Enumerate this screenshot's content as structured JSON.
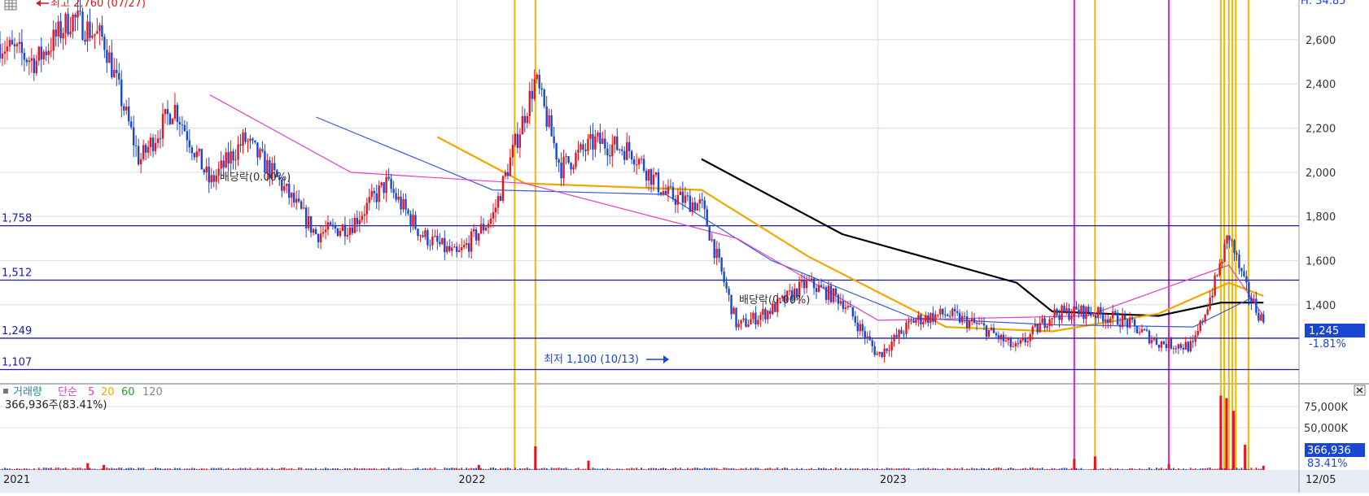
{
  "colors": {
    "price_up": "#e8141b",
    "price_down": "#1a46d6",
    "support_line": "#1a1aa0",
    "ma_black": "#000000",
    "ma_orange": "#f0a800",
    "ma_magenta": "#e040c0",
    "ma_gray": "#888888",
    "ma_green": "#2aa02a",
    "ma_blue": "#3a5ad8",
    "vline_yellow": "#f7b500",
    "vline_magenta": "#e020e0",
    "current_tag_bg": "#1a46d6",
    "axis_bg": "#e8ecf4",
    "grid": "#d8dce4"
  },
  "icons": {
    "chart_menu": "grid-menu-icon",
    "close": "close-icon",
    "legend_bullet": "square-bullet-icon"
  },
  "price_panel": {
    "top_right_label": "H: 34.85",
    "high_annotation": "최고 2,760 (07/27)",
    "low_annotation": "최저 1,100 (10/13)",
    "dividend_labels": [
      "배당락(0.00%)",
      "배당락(0.00%)"
    ],
    "current_price": "1,245",
    "current_change": "-1.81%"
  },
  "volume_panel": {
    "legend": {
      "volume_label": "거래량",
      "ma_type": "단순",
      "periods": [
        "5",
        "20",
        "60",
        "120"
      ]
    },
    "summary": "366,936주(83.41%)",
    "current_volume": "366,936",
    "current_pct": "83.41%"
  },
  "x_axis": {
    "labels": [
      "2021",
      "2022",
      "2023",
      "12/05"
    ]
  },
  "chart_data": [
    {
      "type": "line",
      "subtype": "candlestick",
      "y_axis": {
        "ylim": [
          1050,
          2780
        ],
        "ticks": [
          1400,
          1600,
          1800,
          2000,
          2200,
          2400,
          2600
        ],
        "tick_labels": [
          "1,400",
          "1,600",
          "1,800",
          "2,000",
          "2,200",
          "2,400",
          "2,600"
        ]
      },
      "x_range": [
        "2020-12-01",
        "2023-12-05"
      ],
      "support_levels": [
        {
          "label": "1,758",
          "value": 1758
        },
        {
          "label": "1,512",
          "value": 1512
        },
        {
          "label": "1,249",
          "value": 1249
        },
        {
          "label": "1,107",
          "value": 1107
        }
      ],
      "price_path": [
        {
          "date": "2020-12-01",
          "value": 2580
        },
        {
          "date": "2021-01-01",
          "value": 2500
        },
        {
          "date": "2021-02-01",
          "value": 2700
        },
        {
          "date": "2021-03-01",
          "value": 2600
        },
        {
          "date": "2021-04-01",
          "value": 2050
        },
        {
          "date": "2021-05-01",
          "value": 2300
        },
        {
          "date": "2021-06-01",
          "value": 1950
        },
        {
          "date": "2021-07-01",
          "value": 2150
        },
        {
          "date": "2021-08-01",
          "value": 1950
        },
        {
          "date": "2021-09-01",
          "value": 1720
        },
        {
          "date": "2021-10-01",
          "value": 1760
        },
        {
          "date": "2021-11-01",
          "value": 1950
        },
        {
          "date": "2021-12-01",
          "value": 1720
        },
        {
          "date": "2022-01-01",
          "value": 1620
        },
        {
          "date": "2022-02-01",
          "value": 1800
        },
        {
          "date": "2022-03-10",
          "value": 2420
        },
        {
          "date": "2022-04-01",
          "value": 2020
        },
        {
          "date": "2022-05-01",
          "value": 2140
        },
        {
          "date": "2022-06-01",
          "value": 2100
        },
        {
          "date": "2022-07-01",
          "value": 1900
        },
        {
          "date": "2022-08-01",
          "value": 1850
        },
        {
          "date": "2022-09-01",
          "value": 1300
        },
        {
          "date": "2022-10-01",
          "value": 1380
        },
        {
          "date": "2022-11-01",
          "value": 1500
        },
        {
          "date": "2022-12-01",
          "value": 1420
        },
        {
          "date": "2023-01-01",
          "value": 1170
        },
        {
          "date": "2023-02-01",
          "value": 1330
        },
        {
          "date": "2023-03-01",
          "value": 1360
        },
        {
          "date": "2023-04-01",
          "value": 1300
        },
        {
          "date": "2023-05-01",
          "value": 1200
        },
        {
          "date": "2023-06-01",
          "value": 1360
        },
        {
          "date": "2023-07-01",
          "value": 1370
        },
        {
          "date": "2023-08-01",
          "value": 1330
        },
        {
          "date": "2023-09-01",
          "value": 1230
        },
        {
          "date": "2023-10-01",
          "value": 1210
        },
        {
          "date": "2023-10-20",
          "value": 1500
        },
        {
          "date": "2023-11-01",
          "value": 1720
        },
        {
          "date": "2023-11-15",
          "value": 1480
        },
        {
          "date": "2023-12-01",
          "value": 1320
        }
      ],
      "moving_averages": [
        {
          "color_key": "ma_black",
          "points": [
            {
              "date": "2022-08-01",
              "value": 2060
            },
            {
              "date": "2022-12-01",
              "value": 1720
            },
            {
              "date": "2023-05-01",
              "value": 1500
            },
            {
              "date": "2023-06-01",
              "value": 1370
            },
            {
              "date": "2023-09-01",
              "value": 1350
            },
            {
              "date": "2023-10-25",
              "value": 1410
            },
            {
              "date": "2023-12-01",
              "value": 1410
            }
          ]
        },
        {
          "color_key": "ma_orange",
          "points": [
            {
              "date": "2021-12-15",
              "value": 2160
            },
            {
              "date": "2022-03-01",
              "value": 1950
            },
            {
              "date": "2022-08-01",
              "value": 1920
            },
            {
              "date": "2022-11-01",
              "value": 1620
            },
            {
              "date": "2023-03-01",
              "value": 1300
            },
            {
              "date": "2023-06-01",
              "value": 1280
            },
            {
              "date": "2023-09-01",
              "value": 1360
            },
            {
              "date": "2023-11-01",
              "value": 1500
            },
            {
              "date": "2023-12-01",
              "value": 1440
            }
          ]
        },
        {
          "color_key": "ma_blue",
          "points": [
            {
              "date": "2021-09-01",
              "value": 2250
            },
            {
              "date": "2022-02-01",
              "value": 1920
            },
            {
              "date": "2022-07-01",
              "value": 1900
            },
            {
              "date": "2022-10-01",
              "value": 1600
            },
            {
              "date": "2023-02-01",
              "value": 1340
            },
            {
              "date": "2023-06-01",
              "value": 1310
            },
            {
              "date": "2023-10-01",
              "value": 1300
            },
            {
              "date": "2023-11-20",
              "value": 1430
            }
          ]
        },
        {
          "color_key": "ma_magenta",
          "points": [
            {
              "date": "2021-06-01",
              "value": 2350
            },
            {
              "date": "2021-10-01",
              "value": 2000
            },
            {
              "date": "2022-03-01",
              "value": 1950
            },
            {
              "date": "2022-09-01",
              "value": 1700
            },
            {
              "date": "2023-01-01",
              "value": 1330
            },
            {
              "date": "2023-07-01",
              "value": 1350
            },
            {
              "date": "2023-11-01",
              "value": 1580
            },
            {
              "date": "2023-12-01",
              "value": 1350
            }
          ]
        }
      ],
      "vertical_markers": [
        {
          "date": "2022-02-20",
          "color_key": "vline_yellow"
        },
        {
          "date": "2022-03-10",
          "color_key": "vline_yellow"
        },
        {
          "date": "2023-06-20",
          "color_key": "vline_magenta"
        },
        {
          "date": "2023-07-08",
          "color_key": "vline_yellow"
        },
        {
          "date": "2023-09-10",
          "color_key": "vline_magenta"
        },
        {
          "date": "2023-10-25",
          "color_key": "vline_yellow"
        },
        {
          "date": "2023-10-28",
          "color_key": "vline_yellow"
        },
        {
          "date": "2023-11-01",
          "color_key": "vline_yellow"
        },
        {
          "date": "2023-11-04",
          "color_key": "vline_yellow"
        },
        {
          "date": "2023-11-07",
          "color_key": "vline_yellow"
        },
        {
          "date": "2023-11-18",
          "color_key": "vline_yellow"
        }
      ]
    },
    {
      "type": "bar",
      "y_axis": {
        "ylim": [
          0,
          100000
        ],
        "ticks": [
          50000,
          75000
        ],
        "tick_labels": [
          "50,000K",
          "75,000K"
        ]
      },
      "spikes": [
        {
          "date": "2021-02-15",
          "value": 8000
        },
        {
          "date": "2021-03-01",
          "value": 6000
        },
        {
          "date": "2022-01-20",
          "value": 6000
        },
        {
          "date": "2022-03-10",
          "value": 28000
        },
        {
          "date": "2022-04-25",
          "value": 11000
        },
        {
          "date": "2023-06-20",
          "value": 13000
        },
        {
          "date": "2023-07-08",
          "value": 16000
        },
        {
          "date": "2023-09-10",
          "value": 7000
        },
        {
          "date": "2023-10-25",
          "value": 88000
        },
        {
          "date": "2023-10-30",
          "value": 85000
        },
        {
          "date": "2023-11-05",
          "value": 70000
        },
        {
          "date": "2023-11-15",
          "value": 30000
        },
        {
          "date": "2023-12-01",
          "value": 5000
        }
      ]
    }
  ]
}
